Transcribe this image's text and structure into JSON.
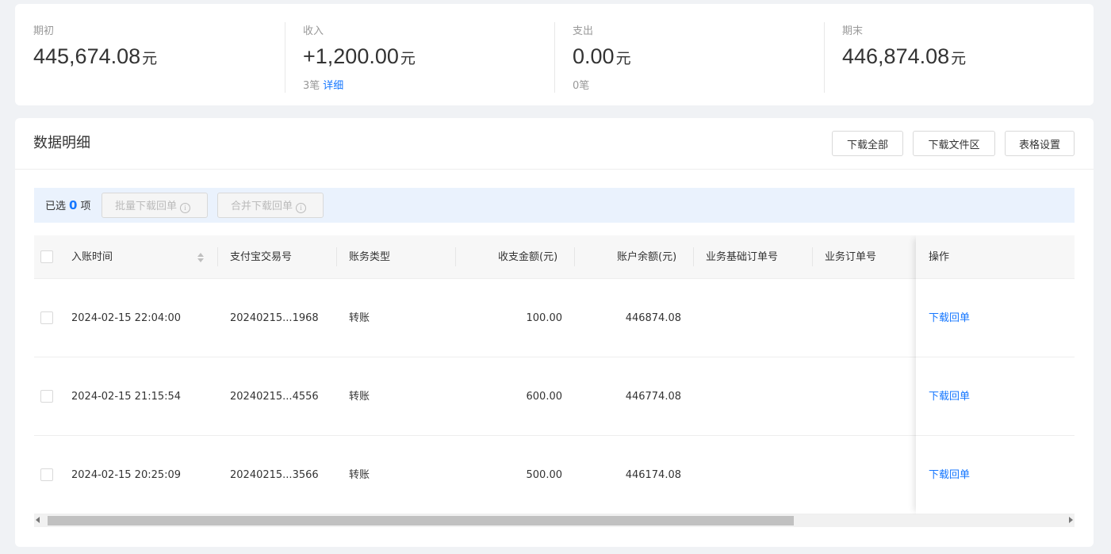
{
  "summary": {
    "opening": {
      "label": "期初",
      "value": "445,674.08",
      "unit": "元"
    },
    "income": {
      "label": "收入",
      "value": "+1,200.00",
      "unit": "元",
      "count": "3笔",
      "detail_link": "详细"
    },
    "expense": {
      "label": "支出",
      "value": "0.00",
      "unit": "元",
      "count": "0笔"
    },
    "closing": {
      "label": "期末",
      "value": "446,874.08",
      "unit": "元"
    }
  },
  "detail": {
    "title": "数据明细",
    "buttons": {
      "download_all": "下载全部",
      "download_files": "下载文件区",
      "table_settings": "表格设置"
    }
  },
  "selection": {
    "prefix": "已选",
    "count": "0",
    "suffix": "项",
    "batch_download": "批量下载回单",
    "merge_download": "合并下载回单",
    "info_icon_glyph": "i"
  },
  "table": {
    "columns": {
      "time": "入账时间",
      "trade_no": "支付宝交易号",
      "type": "账务类型",
      "amount": "收支金额(元)",
      "balance": "账户余额(元)",
      "base_order": "业务基础订单号",
      "order": "业务订单号",
      "action": "操作"
    },
    "rows": [
      {
        "time": "2024-02-15 22:04:00",
        "trade_no": "20240215...1968",
        "type": "转账",
        "amount": "100.00",
        "balance": "446874.08",
        "base_order": "",
        "order": "",
        "action": "下载回单"
      },
      {
        "time": "2024-02-15 21:15:54",
        "trade_no": "20240215...4556",
        "type": "转账",
        "amount": "600.00",
        "balance": "446774.08",
        "base_order": "",
        "order": "",
        "action": "下载回单"
      },
      {
        "time": "2024-02-15 20:25:09",
        "trade_no": "20240215...3566",
        "type": "转账",
        "amount": "500.00",
        "balance": "446174.08",
        "base_order": "",
        "order": "",
        "action": "下载回单"
      }
    ],
    "horizontal_scroll_position": 0
  },
  "colors": {
    "accent": "#1677ff",
    "page_bg": "#f0f2f5",
    "selbar_bg": "#eaf2fd"
  }
}
